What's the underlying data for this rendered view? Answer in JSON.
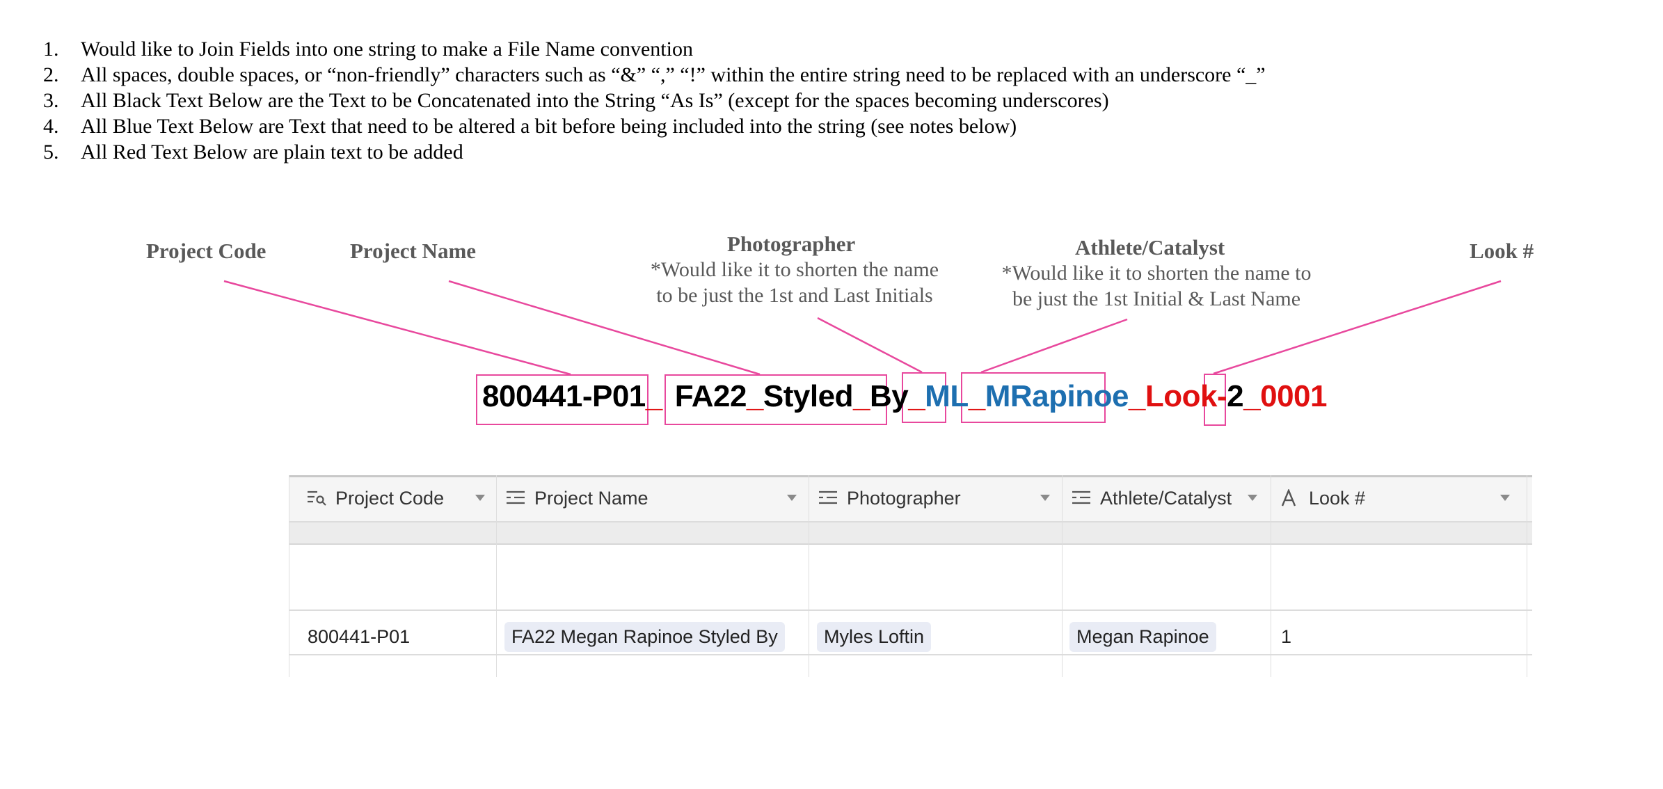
{
  "instructions": [
    {
      "num": "1.",
      "text": "Would like to Join Fields into one string to make a File Name convention"
    },
    {
      "num": "2.",
      "text": "All spaces, double spaces, or “non-friendly” characters such as “&” “,” “!” within the entire string need to be replaced with an underscore “_”"
    },
    {
      "num": "3.",
      "text": "All Black Text Below are the Text to be Concatenated into the String “As Is” (except for the spaces becoming underscores)"
    },
    {
      "num": "4.",
      "text": "All Blue Text Below are Text that need to be altered a bit before being included into the string (see notes below)"
    },
    {
      "num": "5.",
      "text": "All Red Text Below are plain text to be added"
    }
  ],
  "labels": {
    "project_code": "Project Code",
    "project_name": "Project Name",
    "photographer": "Photographer",
    "photographer_note_1": "*Would like it to shorten the name",
    "photographer_note_2": "to be just the 1st and Last Initials",
    "athlete": "Athlete/Catalyst",
    "athlete_note_1": "*Would like it to shorten the name to",
    "athlete_note_2": "be just the 1st Initial & Last Name",
    "look": "Look #"
  },
  "filename": {
    "code": "800441-P01",
    "sep1": "_",
    "name_a": "FA22",
    "sep2": "_",
    "name_b": "Styled",
    "sep3": "_",
    "name_c": "By",
    "sep4": "_",
    "photographer": "ML",
    "sep5": "_",
    "athlete": "MRapinoe",
    "look_prefix": "_Look-",
    "look_num": "2",
    "suffix": "_0001"
  },
  "colors": {
    "black": "#000000",
    "blue": "#1d6fb0",
    "red": "#e01010",
    "pink": "#e8489d"
  },
  "table": {
    "columns": [
      {
        "label": "Project Code",
        "icon": "lookup-icon"
      },
      {
        "label": "Project Name",
        "icon": "linked-record-icon"
      },
      {
        "label": "Photographer",
        "icon": "linked-record-icon"
      },
      {
        "label": "Athlete/Catalyst",
        "icon": "linked-record-icon"
      },
      {
        "label": "Look #",
        "icon": "text-field-icon"
      }
    ],
    "row": {
      "project_code": "800441-P01",
      "project_name": "FA22 Megan Rapinoe Styled By",
      "photographer": "Myles Loftin",
      "athlete": "Megan Rapinoe",
      "look": "1"
    }
  }
}
